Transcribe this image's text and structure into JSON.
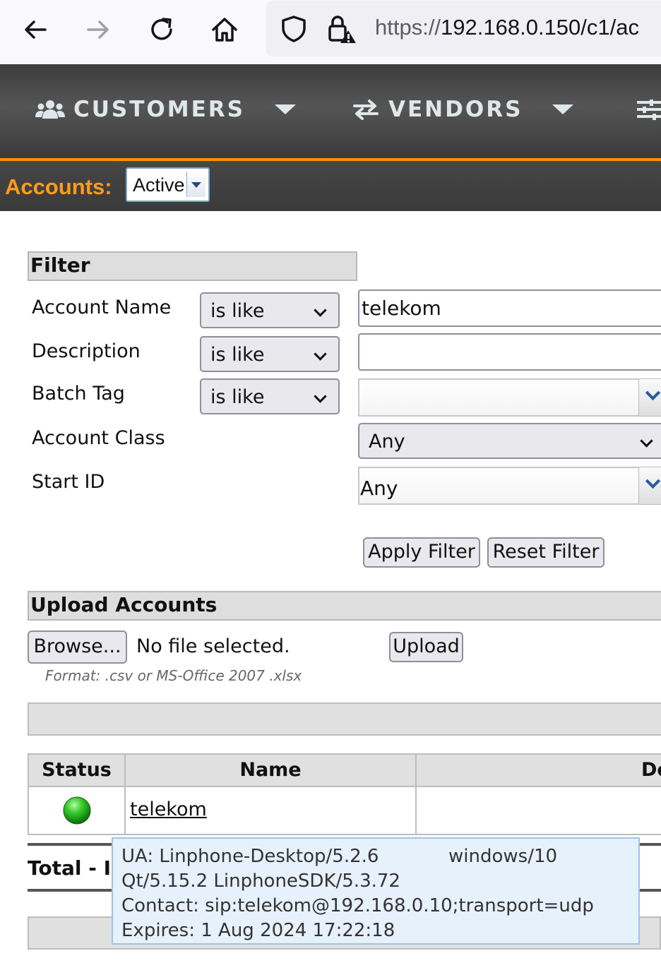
{
  "browser": {
    "url_scheme": "https://",
    "url_host": "192.168.0.150",
    "url_path": "/c1/ac"
  },
  "nav": {
    "items": [
      {
        "label": "CUSTOMERS",
        "icon": "users-icon"
      },
      {
        "label": "VENDORS",
        "icon": "swap-arrows-icon"
      }
    ]
  },
  "accounts_bar": {
    "label": "Accounts:",
    "selected": "Active"
  },
  "filter": {
    "title": "Filter",
    "rows": {
      "account_name": {
        "label": "Account Name",
        "operator": "is like",
        "value": "telekom"
      },
      "description": {
        "label": "Description",
        "operator": "is like",
        "value": ""
      },
      "batch_tag": {
        "label": "Batch Tag",
        "operator": "is like",
        "value": ""
      },
      "account_class": {
        "label": "Account Class",
        "value": "Any"
      },
      "start_id": {
        "label": "Start ID",
        "value": "Any"
      }
    },
    "apply_label": "Apply Filter",
    "reset_label": "Reset Filter"
  },
  "upload": {
    "title": "Upload Accounts",
    "browse_label": "Browse...",
    "file_status": "No file selected.",
    "upload_label": "Upload",
    "format_hint": "Format: .csv or MS-Office 2007 .xlsx"
  },
  "table": {
    "headers": [
      "Status",
      "Name",
      "De"
    ],
    "rows": [
      {
        "status": "online",
        "status_color": "#22b422",
        "name": "telekom"
      }
    ],
    "total_label": "Total - I"
  },
  "tooltip": {
    "ua": "UA: Linphone-Desktop/5.2.6",
    "os": "windows/10",
    "qt": "Qt/5.15.2 LinphoneSDK/5.3.72",
    "contact": "Contact: sip:telekom@192.168.0.10;transport=udp",
    "expires": "Expires: 1 Aug 2024 17:22:18"
  },
  "colors": {
    "accent": "#ff9400",
    "nav_text": "#dfe7ea",
    "status_online": "#22b422"
  }
}
